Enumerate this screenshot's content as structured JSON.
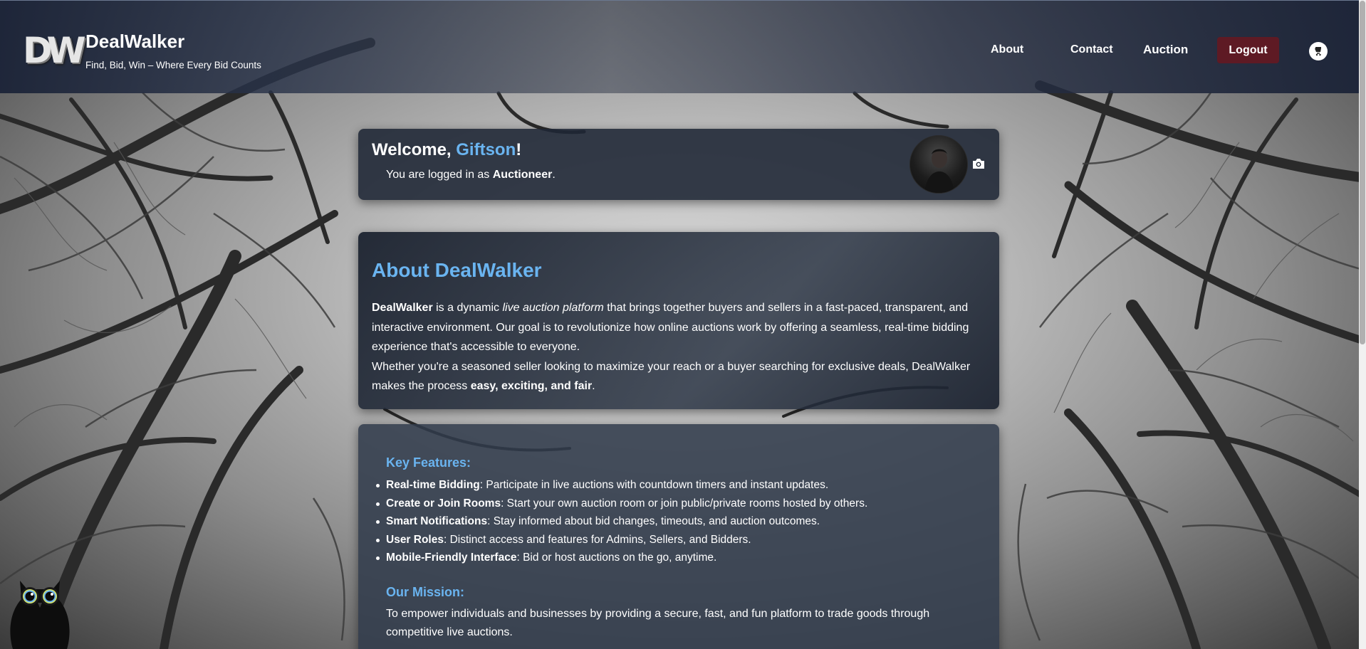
{
  "brand": {
    "logo_text": "DW",
    "name": "DealWalker",
    "tagline": "Find, Bid, Win – Where Every Bid Counts"
  },
  "nav": {
    "about": "About",
    "contact": "Contact",
    "auction": "Auction",
    "logout": "Logout",
    "cart_icon": "cart-icon"
  },
  "welcome": {
    "prefix": "Welcome, ",
    "username": "Giftson",
    "suffix": "!",
    "role_prefix": "You are logged in as ",
    "role": "Auctioneer",
    "role_suffix": ".",
    "avatar_icon": "avatar",
    "upload_icon": "camera-icon"
  },
  "about": {
    "title": "About DealWalker",
    "p1_bold": "DealWalker",
    "p1_text1": " is a dynamic ",
    "p1_italic": "live auction platform",
    "p1_text2": " that brings together buyers and sellers in a fast-paced, transparent, and interactive environment. Our goal is to revolutionize how online auctions work by offering a seamless, real-time bidding experience that's accessible to everyone.",
    "p2_text": "Whether you're a seasoned seller looking to maximize your reach or a buyer searching for exclusive deals, DealWalker makes the process ",
    "p2_bold": "easy, exciting, and fair",
    "p2_end": "."
  },
  "features": {
    "heading": "Key Features:",
    "items": [
      {
        "title": "Real-time Bidding",
        "desc": ": Participate in live auctions with countdown timers and instant updates."
      },
      {
        "title": "Create or Join Rooms",
        "desc": ": Start your own auction room or join public/private rooms hosted by others."
      },
      {
        "title": "Smart Notifications",
        "desc": ": Stay informed about bid changes, timeouts, and auction outcomes."
      },
      {
        "title": "User Roles",
        "desc": ": Distinct access and features for Admins, Sellers, and Bidders."
      },
      {
        "title": "Mobile-Friendly Interface",
        "desc": ": Bid or host auctions on the go, anytime."
      }
    ]
  },
  "mission": {
    "heading": "Our Mission:",
    "text": "To empower individuals and businesses by providing a secure, fast, and fun platform to trade goods through competitive live auctions."
  },
  "mascot_icon": "owl-icon",
  "colors": {
    "accent": "#6ab4f0",
    "logout": "#5e1a24",
    "card": "#1e2634"
  }
}
